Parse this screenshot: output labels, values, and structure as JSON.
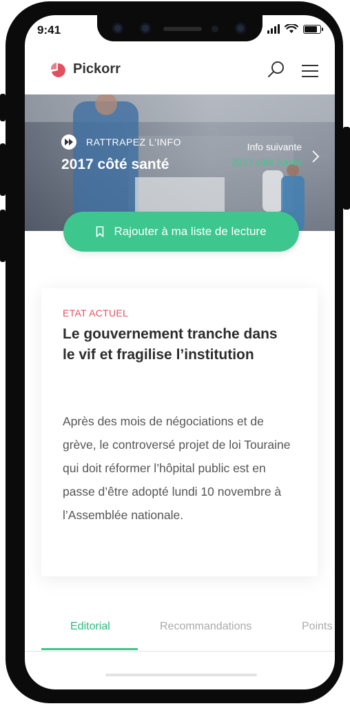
{
  "status_bar": {
    "time": "9:41"
  },
  "header": {
    "brand": "Pickorr",
    "search_icon": "search-icon",
    "menu_icon": "hamburger-menu-icon",
    "accent": "#e2505f"
  },
  "hero": {
    "kicker": "RATTRAPEZ L'INFO",
    "title": "2017 côté santé",
    "next_label": "Info suivante",
    "next_title": "2017 côté Santé"
  },
  "cta": {
    "label": "Rajouter à ma liste de lecture",
    "color": "#3dc68e"
  },
  "article": {
    "kicker": "ETAT ACTUEL",
    "title": "Le gouvernement tranche dans le vif et fragilise l’institution",
    "body": "Après des mois de négociations et de grève, le controversé projet de loi Touraine qui doit réformer l’hôpital public est en passe d’être adopté lundi 10 novembre à l’Assemblée nationale."
  },
  "tabs": [
    {
      "label": "Editorial",
      "active": true
    },
    {
      "label": "Recommandations",
      "active": false
    },
    {
      "label": "Points",
      "active": false
    }
  ]
}
